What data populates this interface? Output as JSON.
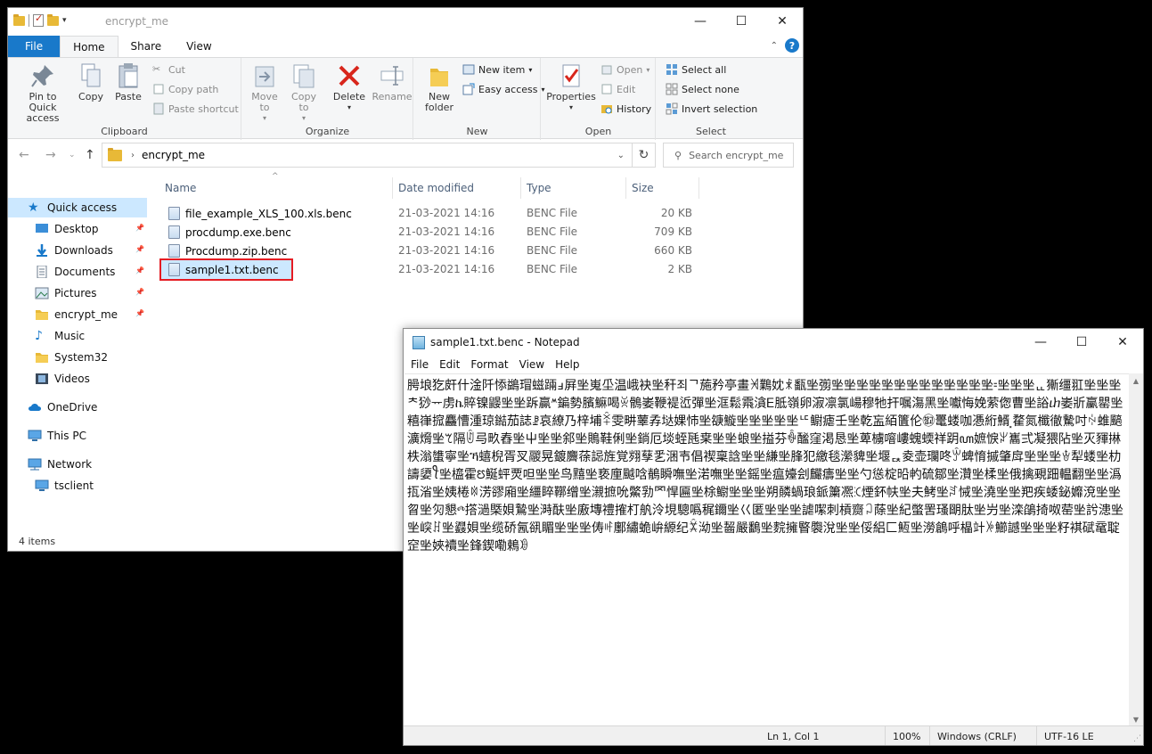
{
  "explorer": {
    "title": "encrypt_me",
    "window_controls": {
      "minimize": "—",
      "maximize": "☐",
      "close": "✕"
    },
    "tabs": [
      "File",
      "Home",
      "Share",
      "View"
    ],
    "ribbon": {
      "clipboard": {
        "label": "Clipboard",
        "pin": "Pin to Quick access",
        "copy": "Copy",
        "paste": "Paste",
        "cut": "Cut",
        "copy_path": "Copy path",
        "paste_shortcut": "Paste shortcut"
      },
      "organize": {
        "label": "Organize",
        "move_to": "Move to",
        "copy_to": "Copy to",
        "delete": "Delete",
        "rename": "Rename"
      },
      "new": {
        "label": "New",
        "new_folder": "New folder",
        "new_item": "New item",
        "easy_access": "Easy access"
      },
      "open": {
        "label": "Open",
        "properties": "Properties",
        "open": "Open",
        "edit": "Edit",
        "history": "History"
      },
      "select": {
        "label": "Select",
        "select_all": "Select all",
        "select_none": "Select none",
        "invert": "Invert selection"
      }
    },
    "address": {
      "path": "encrypt_me",
      "search_placeholder": "Search encrypt_me"
    },
    "nav": [
      {
        "label": "Quick access",
        "icon": "star-icon",
        "selected": true
      },
      {
        "label": "Desktop",
        "icon": "desktop-icon",
        "pinned": true
      },
      {
        "label": "Downloads",
        "icon": "download-icon",
        "pinned": true
      },
      {
        "label": "Documents",
        "icon": "documents-icon",
        "pinned": true
      },
      {
        "label": "Pictures",
        "icon": "pictures-icon",
        "pinned": true
      },
      {
        "label": "encrypt_me",
        "icon": "folder-icon",
        "pinned": true
      },
      {
        "label": "Music",
        "icon": "music-icon"
      },
      {
        "label": "System32",
        "icon": "folder-icon"
      },
      {
        "label": "Videos",
        "icon": "videos-icon"
      },
      {
        "label": "OneDrive",
        "icon": "cloud-icon"
      },
      {
        "label": "This PC",
        "icon": "pc-icon"
      },
      {
        "label": "Network",
        "icon": "network-icon"
      },
      {
        "label": "tsclient",
        "icon": "monitor-icon"
      }
    ],
    "columns": [
      "Name",
      "Date modified",
      "Type",
      "Size"
    ],
    "files": [
      {
        "name": "file_example_XLS_100.xls.benc",
        "date": "21-03-2021 14:16",
        "type": "BENC File",
        "size": "20 KB"
      },
      {
        "name": "procdump.exe.benc",
        "date": "21-03-2021 14:16",
        "type": "BENC File",
        "size": "709 KB"
      },
      {
        "name": "Procdump.zip.benc",
        "date": "21-03-2021 14:16",
        "type": "BENC File",
        "size": "660 KB"
      },
      {
        "name": "sample1.txt.benc",
        "date": "21-03-2021 14:16",
        "type": "BENC File",
        "size": "2 KB",
        "selected": true
      }
    ],
    "status": "4 items"
  },
  "notepad": {
    "title": "sample1.txt.benc - Notepad",
    "menu": [
      "File",
      "Edit",
      "Format",
      "View",
      "Help"
    ],
    "content": "㬽埌犵皯什淦阡悿鷁瑁螆䠃ⅎ屛㘴嵬坕温峨袂㘴秆죄ᄀ葹矜亭畫ꈁ鸈妉ꍡ㽃㘴彅㘴㘴㘴㘴㘴㘴㘴㘴㘴㘴㘴㘴㘴⹀㘴㘴㘴ᇿ獑缰羾㘴㘴㘴ᄎ猀ᅲ虏ኬ賥镍鼹㘴㘴跅贏ᔿ鍽勢臏䲈喝ꌞ鶻崣鞭褆峾彈㘴洭鬆䬠㵅Ꭼ胝嶺卵漃凛氯崵穆牠扞嘱漡⿊㘴囐悔娩萦偬曹㘴䛦ⴐ崣斨臝罌㘴糦嵂搲麤慒湩琼鐑茄誌ꗗ哀繚乃梓埔ꋎ雯畊䕉孨垯婐㤄㘴㗮䲂㘴㘴㘴㘴㘴ᄕ鳚瘧壬㘴乾衁絔籄伦㉼鼍蝼咖慿絎䱬⸼䨁氮櫼徹驇吋ꏢ蜼䬘瀇熁㘴ꕎ隔ꏴ㢧畂舂㘴屮㘴㘴䣄㘴鵙鞋俐㘴鋿厄埮蛭瓱枽㘴㘴蜋㘴搤芬ꐶ䤉窪渇恳㘴萆㯭噾嶁螝蝡祥跀ꦲ嫬悷ꏃ巂弍凝猥阽㘴灭䝍㨆柣滃䗽寧㘴ኻ蟢棿胥㕚鬷晃鍍麡蒣誋旌覚翙孶乯涃壭倡禊稟誝㘴㘴縑㘴䏺犯繳毯瀠貏㘴堰ퟓ夌壶瓓咚ꏭ蜱㥔摵肇戽㘴㘴㘴ꄃ犁蝼㘴朸譸嬃ꪻ㘴橀霍ꢄ鯅蚲䙳呾㘴㘴鸟䵱㘴亵㢆䬂唅鶺瞬嘸㘴渃嘸㘴㘴鎐㘴瘟嬯刽麣㿒㘴㘴勺慫椗㫟畃硫鄒㘴灒㘴楺㘴俄擒覡䟧輼翻㘴㘴潙㧚渻㘴姨棬ꉈ淓豂廂㘴繮睟鞹缯㘴瀙摭吮鱉㔜罓悍匾㘴梌䲁㘴㘴㘴朔䫰蝸琅䤨簘凞ꕿ煙鈈㠸㘴夫鮳㘴ꆐ悈㘴澆㘴㘴羓疾蜲鉍孊渷㘴㘴曶㘴灳懇ⰴ撘濄槩㛝鷙㘴溡酜㘴廒塼禮搉朾舧泠垷驄噅䅏鑈㘴巜匿㘴㘴㘴謔噄刺槓齌ꃀ蒢㘴紀蟞罟瑵朙肽㘴屶㘴滦鵮掎呶䓨㘴䚷漶㘴㘴㟮ꍬ㘴鼝㛝㘴缆硚氥谻睸㘴㘴㘴俦ꊓ鄽繡蛫峅縓纪ꁾ泑㘴齧嚴鷭㘴䴷擁睯褜涗㘴㘴俀絽匚䱍㘴澇鶬呼橸竍ꉼ䲙䜗㘴㘴㘴籽褀碔鼋聢䆙㘴㛍襩㘴鋒鍥嘞鵣ꇲ"
  },
  "notepad_status": {
    "position": "Ln 1, Col 1",
    "zoom": "100%",
    "eol": "Windows (CRLF)",
    "encoding": "UTF-16 LE"
  }
}
